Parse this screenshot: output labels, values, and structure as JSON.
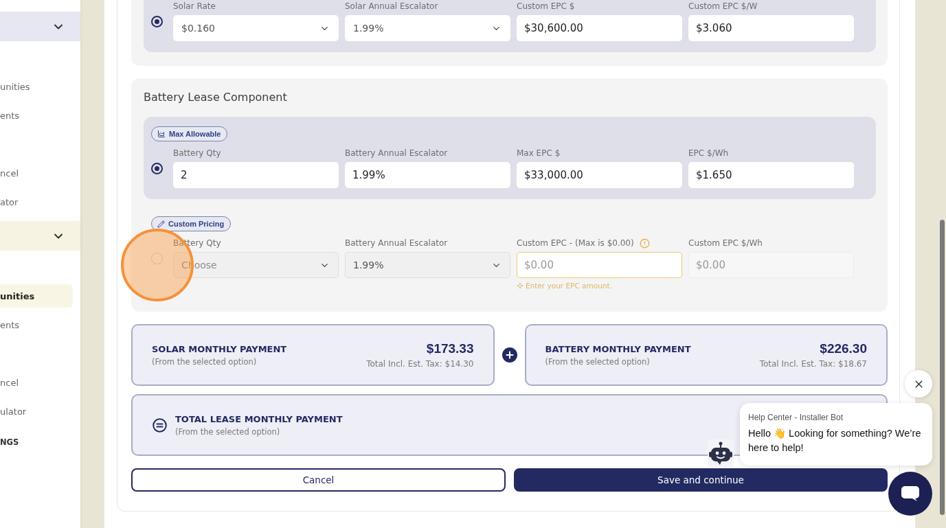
{
  "sidebar": {
    "groups": [
      {
        "color": "#e7e7f1",
        "expanded": true,
        "items": [
          {
            "label": "unities",
            "selected": false
          },
          {
            "label": "ents",
            "selected": false
          },
          {
            "label": "ncel",
            "selected": false
          },
          {
            "label": "ator",
            "selected": false
          }
        ]
      },
      {
        "color": "#f7f3e2",
        "expanded": true,
        "items": [
          {
            "label": "unities",
            "selected": true
          },
          {
            "label": "ents",
            "selected": false
          },
          {
            "label": "ncel",
            "selected": false
          },
          {
            "label": "ulator",
            "selected": false
          }
        ]
      }
    ],
    "footer": "NGS"
  },
  "solar_section": {
    "options": [
      {
        "selected": true,
        "clicked": false,
        "fields": [
          {
            "label": "Solar Rate",
            "kind": "select",
            "value": "$0.160",
            "disabled": false,
            "warning": false
          },
          {
            "label": "Solar Annual Escalator",
            "kind": "select",
            "value": "1.99%",
            "disabled": false,
            "warning": false
          },
          {
            "label": "Custom EPC $",
            "kind": "input",
            "value": "$30,600.00",
            "disabled": false,
            "warning": false
          },
          {
            "label": "Custom EPC $/W",
            "kind": "input",
            "value": "$3.060",
            "disabled": false,
            "warning": false
          }
        ]
      }
    ]
  },
  "battery_section": {
    "title": "Battery Lease Component",
    "options": [
      {
        "badge": {
          "kind": "chart",
          "label": "Max Allowable"
        },
        "selected": true,
        "clicked": false,
        "fields": [
          {
            "label": "Battery Qty",
            "kind": "input",
            "value": "2",
            "disabled": false,
            "warning": false
          },
          {
            "label": "Battery Annual Escalator",
            "kind": "input",
            "value": "1.99%",
            "disabled": false,
            "warning": false
          },
          {
            "label": "Max EPC $",
            "kind": "input",
            "value": "$33,000.00",
            "disabled": false,
            "warning": false
          },
          {
            "label": "EPC $/Wh",
            "kind": "input",
            "value": "$1.650",
            "disabled": false,
            "warning": false
          }
        ]
      },
      {
        "badge": {
          "kind": "pencil",
          "label": "Custom Pricing"
        },
        "selected": false,
        "clicked": true,
        "fields": [
          {
            "label": "Battery Qty",
            "kind": "select",
            "placeholder": "Choose",
            "disabled": true,
            "warning": false
          },
          {
            "label": "Battery Annual Escalator",
            "kind": "select",
            "value": "1.99%",
            "disabled": true,
            "warning": false
          },
          {
            "label": "Custom EPC - (Max is $0.00)",
            "kind": "input",
            "placeholder": "$0.00",
            "disabled": false,
            "warning": true,
            "hint": "Enter your EPC amount."
          },
          {
            "label": "Custom EPC $/Wh",
            "kind": "input",
            "placeholder": "$0.00",
            "disabled": true,
            "warning": false
          }
        ]
      }
    ]
  },
  "payments": [
    {
      "title": "SOLAR MONTHLY PAYMENT",
      "subtitle": "(From the selected option)",
      "amount": "$173.33",
      "tax": "Total Incl. Est. Tax: $14.30"
    },
    {
      "title": "BATTERY MONTHLY PAYMENT",
      "subtitle": "(From the selected option)",
      "amount": "$226.30",
      "tax": "Total Incl. Est. Tax: $18.67"
    }
  ],
  "total": {
    "title": "TOTAL LEASE MONTHLY PAYMENT",
    "subtitle": "(From the selected option)"
  },
  "buttons": [
    {
      "label": "Cancel",
      "kind": "secondary"
    },
    {
      "label": "Save and continue",
      "kind": "primary"
    }
  ],
  "chat": {
    "title": "Help Center - Installer Bot",
    "message": "Hello 👋 Looking for something? We’re here to help!"
  }
}
